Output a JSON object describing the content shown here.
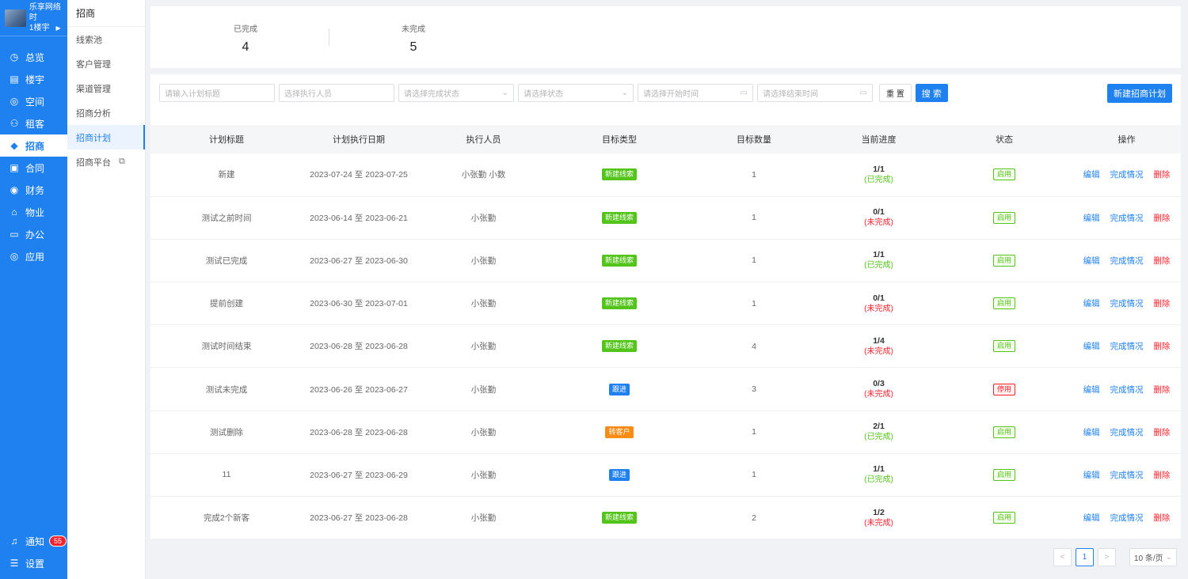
{
  "brand": {
    "name": "乐享网络时",
    "building": "1楼宇"
  },
  "nav": [
    {
      "icon": "◷",
      "label": "总览"
    },
    {
      "icon": "▤",
      "label": "楼宇"
    },
    {
      "icon": "◎",
      "label": "空间"
    },
    {
      "icon": "⚇",
      "label": "租客"
    },
    {
      "icon": "◆",
      "label": "招商",
      "active": true
    },
    {
      "icon": "▣",
      "label": "合同"
    },
    {
      "icon": "◉",
      "label": "财务"
    },
    {
      "icon": "⌂",
      "label": "物业"
    },
    {
      "icon": "▭",
      "label": "办公"
    },
    {
      "icon": "◎",
      "label": "应用"
    }
  ],
  "nav_bottom": {
    "notify_label": "通知",
    "notify_count": "55",
    "settings_label": "设置"
  },
  "submenu": {
    "title": "招商",
    "items": [
      {
        "label": "线索池"
      },
      {
        "label": "客户管理"
      },
      {
        "label": "渠道管理"
      },
      {
        "label": "招商分析"
      },
      {
        "label": "招商计划",
        "active": true
      },
      {
        "label": "招商平台",
        "external": true
      }
    ]
  },
  "stats": {
    "done_label": "已完成",
    "done_value": "4",
    "undone_label": "未完成",
    "undone_value": "5"
  },
  "filters": {
    "title_placeholder": "请输入计划标题",
    "executor_placeholder": "选择执行人员",
    "complete_status_placeholder": "请选择完成状态",
    "status_placeholder": "请选择状态",
    "start_placeholder": "请选择开始时间",
    "end_placeholder": "请选择结束时间",
    "reset_label": "重 置",
    "search_label": "搜 索",
    "new_label": "新建招商计划"
  },
  "table": {
    "headers": [
      "计划标题",
      "计划执行日期",
      "执行人员",
      "目标类型",
      "目标数量",
      "当前进度",
      "状态",
      "操作"
    ],
    "actions": {
      "edit": "编辑",
      "detail": "完成情况",
      "delete": "删除"
    },
    "rows": [
      {
        "title": "新建",
        "date": "2023-07-24 至 2023-07-25",
        "executor": "小张勤 小数",
        "type": "新建线索",
        "type_color": "#52c41a",
        "count": "1",
        "progress": "1/1",
        "progress_status": "(已完成)",
        "done": true,
        "status": "启用",
        "enabled": true
      },
      {
        "title": "测试之前时间",
        "date": "2023-06-14 至 2023-06-21",
        "executor": "小张勤",
        "type": "新建线索",
        "type_color": "#52c41a",
        "count": "1",
        "progress": "0/1",
        "progress_status": "(未完成)",
        "done": false,
        "status": "启用",
        "enabled": true
      },
      {
        "title": "测试已完成",
        "date": "2023-06-27 至 2023-06-30",
        "executor": "小张勤",
        "type": "新建线索",
        "type_color": "#52c41a",
        "count": "1",
        "progress": "1/1",
        "progress_status": "(已完成)",
        "done": true,
        "status": "启用",
        "enabled": true
      },
      {
        "title": "提前创建",
        "date": "2023-06-30 至 2023-07-01",
        "executor": "小张勤",
        "type": "新建线索",
        "type_color": "#52c41a",
        "count": "1",
        "progress": "0/1",
        "progress_status": "(未完成)",
        "done": false,
        "status": "启用",
        "enabled": true
      },
      {
        "title": "测试时间结束",
        "date": "2023-06-28 至 2023-06-28",
        "executor": "小张勤",
        "type": "新建线索",
        "type_color": "#52c41a",
        "count": "4",
        "progress": "1/4",
        "progress_status": "(未完成)",
        "done": false,
        "status": "启用",
        "enabled": true
      },
      {
        "title": "测试未完成",
        "date": "2023-06-26 至 2023-06-27",
        "executor": "小张勤",
        "type": "跟进",
        "type_color": "#1f80f0",
        "count": "3",
        "progress": "0/3",
        "progress_status": "(未完成)",
        "done": false,
        "status": "停用",
        "enabled": false
      },
      {
        "title": "测试删除",
        "date": "2023-06-28 至 2023-06-28",
        "executor": "小张勤",
        "type": "转客户",
        "type_color": "#fa8c16",
        "count": "1",
        "progress": "2/1",
        "progress_status": "(已完成)",
        "done": true,
        "status": "启用",
        "enabled": true
      },
      {
        "title": "11",
        "date": "2023-06-27 至 2023-06-29",
        "executor": "小张勤",
        "type": "跟进",
        "type_color": "#1f80f0",
        "count": "1",
        "progress": "1/1",
        "progress_status": "(已完成)",
        "done": true,
        "status": "启用",
        "enabled": true
      },
      {
        "title": "完成2个新客",
        "date": "2023-06-27 至 2023-06-28",
        "executor": "小张勤",
        "type": "新建线索",
        "type_color": "#52c41a",
        "count": "2",
        "progress": "1/2",
        "progress_status": "(未完成)",
        "done": false,
        "status": "启用",
        "enabled": true
      }
    ]
  },
  "pagination": {
    "prev": "<",
    "current": "1",
    "next": ">",
    "page_size": "10 条/页"
  },
  "colors": {
    "primary": "#1f80f0",
    "success": "#52c41a",
    "danger": "#f5222d",
    "warning": "#fa8c16"
  }
}
